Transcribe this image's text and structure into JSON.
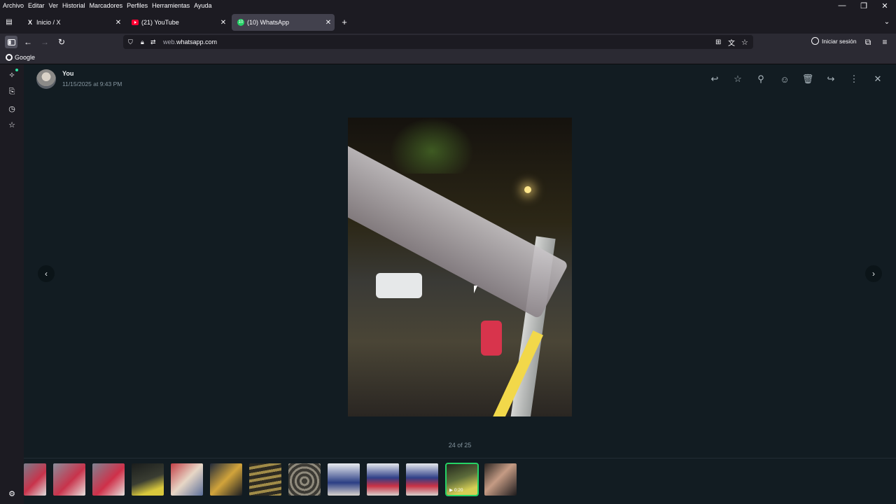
{
  "menubar": {
    "items": [
      "Archivo",
      "Editar",
      "Ver",
      "Historial",
      "Marcadores",
      "Perfiles",
      "Herramientas",
      "Ayuda"
    ]
  },
  "window_controls": {
    "minimize": "—",
    "restore": "❐",
    "close": "✕"
  },
  "tabs": [
    {
      "title": "Inicio / X",
      "icon": "x-logo-icon"
    },
    {
      "title": "(21) YouTube",
      "icon": "youtube-icon"
    },
    {
      "title": "(10) WhatsApp",
      "icon": "whatsapp-icon",
      "badge": "10"
    }
  ],
  "new_tab": "+",
  "urlbar": {
    "prefix": "web.",
    "host": "whatsapp.com"
  },
  "account": {
    "label": "Iniciar sesión"
  },
  "bookmarks": [
    {
      "label": "Google",
      "icon": "google-icon"
    }
  ],
  "viewer": {
    "sender": "You",
    "timestamp": "11/15/2025 at 9:43 PM",
    "counter": "24 of 25",
    "active_thumb_duration": "0:20"
  },
  "colors": {
    "accent_green": "#25d366",
    "viewer_bg": "#121c22"
  }
}
